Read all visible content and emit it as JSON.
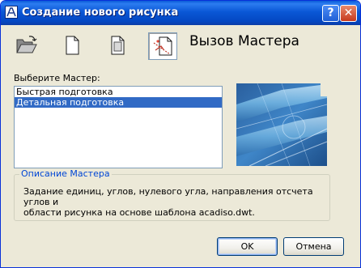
{
  "window": {
    "title": "Создание нового рисунка",
    "help_label": "?",
    "close_label": "✕"
  },
  "toolbar": {
    "items": [
      {
        "icon": "open-folder-icon"
      },
      {
        "icon": "blank-page-icon"
      },
      {
        "icon": "template-page-icon"
      },
      {
        "icon": "wizard-icon",
        "pressed": true
      }
    ],
    "heading": "Вызов Мастера"
  },
  "wizard_list": {
    "label": "Выберите Мастер:",
    "items": [
      {
        "label": "Быстрая подготовка",
        "selected": false
      },
      {
        "label": "Детальная подготовка",
        "selected": true
      }
    ]
  },
  "description": {
    "title": "Описание Мастера",
    "line1": "Задание единиц, углов, нулевого угла, направления отсчета углов и",
    "line2": "области рисунка на основе шаблона acadiso.dwt."
  },
  "buttons": {
    "ok": "OK",
    "cancel": "Отмена"
  },
  "colors": {
    "selection": "#316ac5",
    "title_bar": "#0a57d6",
    "group_title": "#0046d5"
  }
}
